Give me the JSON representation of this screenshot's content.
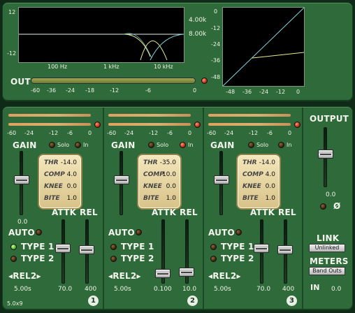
{
  "top": {
    "eq_xticks": [
      "100 Hz",
      "1 kHz",
      "10 kHz"
    ],
    "eq_yticks": [
      "12",
      "-12"
    ],
    "freq_values": [
      "4.00k",
      "8.00k"
    ],
    "transfer_xticks": [
      "-48",
      "-36",
      "-24",
      "-12",
      "0"
    ],
    "transfer_yticks": [
      "0",
      "-12",
      "-24",
      "-36",
      "-48"
    ],
    "out_label": "OUT",
    "out_scale": [
      "-60",
      "-36",
      "-24",
      "-18",
      "-12",
      "-6",
      "0"
    ]
  },
  "bands": [
    {
      "scale": [
        "-60",
        "-24",
        "-12",
        "-6",
        "0"
      ],
      "gain_label": "GAIN",
      "solo": "Solo",
      "in": "In",
      "thr": "-14.0",
      "comp": "4.0",
      "knee": "0.0",
      "bite": "1.0",
      "gain_value": "0.0",
      "attk_label": "ATTK",
      "rel_label": "REL",
      "auto": "AUTO",
      "type1": "TYPE 1",
      "type2": "TYPE 2",
      "rel2": "◂REL2▸",
      "rel2_value": "5.00s",
      "attk_value": "70.0",
      "rel_value": "400",
      "number": "1"
    },
    {
      "scale": [
        "-60",
        "-24",
        "-12",
        "-6",
        "0"
      ],
      "gain_label": "GAIN",
      "solo": "Solo",
      "in": "In",
      "thr": "-35.0",
      "comp": "10.0",
      "knee": "0.0",
      "bite": "1.0",
      "gain_value": "",
      "attk_label": "ATTK",
      "rel_label": "REL",
      "auto": "AUTO",
      "type1": "TYPE 1",
      "type2": "TYPE 2",
      "rel2": "◂REL2▸",
      "rel2_value": "5.00s",
      "attk_value": "0.100",
      "rel_value": "10.0",
      "number": "2"
    },
    {
      "scale": [
        "-60",
        "-24",
        "-12",
        "-6",
        "0"
      ],
      "gain_label": "GAIN",
      "solo": "Solo",
      "in": "In",
      "thr": "-14.0",
      "comp": "4.0",
      "knee": "0.0",
      "bite": "1.0",
      "gain_value": "",
      "attk_label": "ATTK",
      "rel_label": "REL",
      "auto": "AUTO",
      "type1": "TYPE 1",
      "type2": "TYPE 2",
      "rel2": "◂REL2▸",
      "rel2_value": "5.00s",
      "attk_value": "70.0",
      "rel_value": "400",
      "number": "3"
    }
  ],
  "card_labels": {
    "thr": "THR",
    "comp": "COMP",
    "knee": "KNEE",
    "bite": "BITE"
  },
  "output": {
    "label": "OUTPUT",
    "value": "0.0",
    "phase": "Ø",
    "link_label": "LINK",
    "link_button": "Unlinked",
    "meters_label": "METERS",
    "meters_button": "Band Outs",
    "in_value": "0.0",
    "in_icon": "IN"
  },
  "footer": {
    "version": "5.0x9"
  }
}
